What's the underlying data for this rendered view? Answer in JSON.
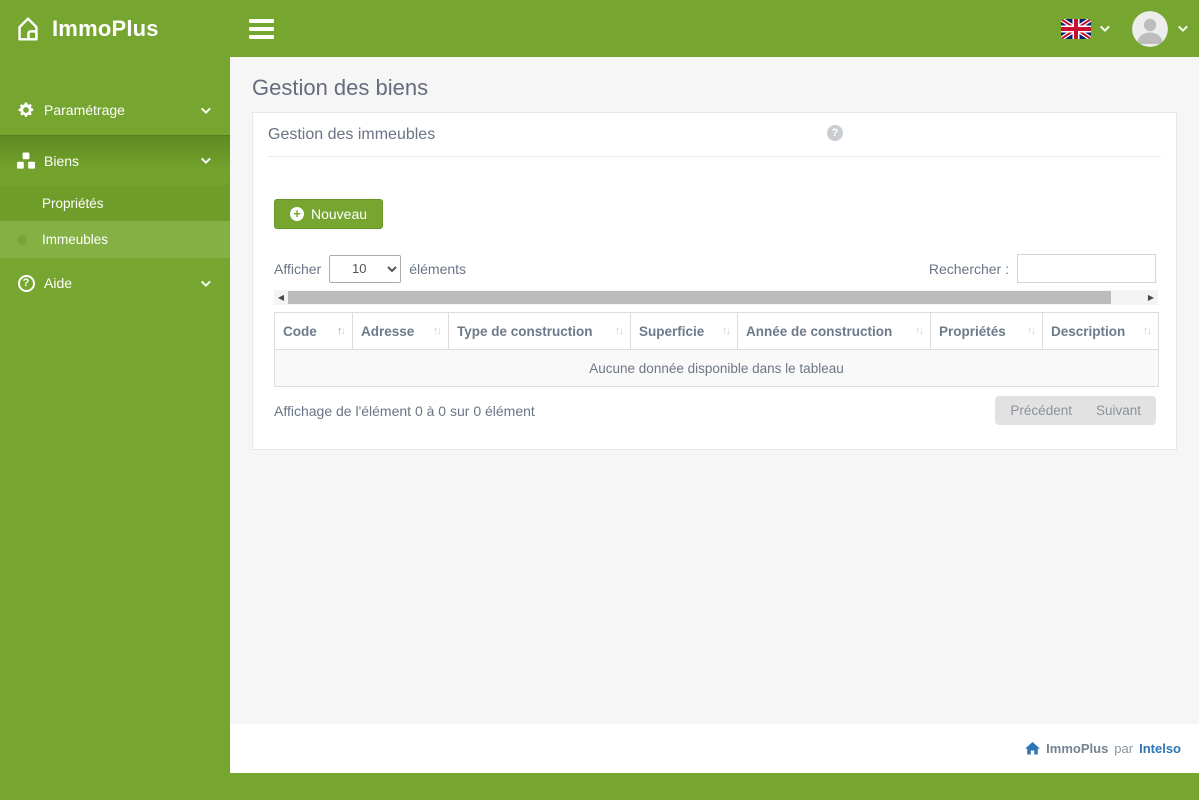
{
  "app": {
    "brand": "ImmoPlus"
  },
  "sidebar": {
    "items": [
      {
        "label": "Paramétrage",
        "icon": "gear-icon"
      },
      {
        "label": "Biens",
        "icon": "cubes-icon",
        "active": true,
        "children": [
          {
            "label": "Propriétés"
          },
          {
            "label": "Immeubles",
            "active": true
          }
        ]
      },
      {
        "label": "Aide",
        "icon": "question-circle-icon"
      }
    ]
  },
  "page": {
    "title": "Gestion des biens"
  },
  "panel": {
    "title": "Gestion des immeubles"
  },
  "toolbar": {
    "new_button": "Nouveau"
  },
  "length_control": {
    "prefix": "Afficher",
    "value": "10",
    "suffix": "éléments"
  },
  "search": {
    "label": "Rechercher :",
    "value": ""
  },
  "table": {
    "columns": [
      "Code",
      "Adresse",
      "Type de construction",
      "Superficie",
      "Année de construction",
      "Propriétés",
      "Description"
    ],
    "sorted_column": "Code",
    "empty_message": "Aucune donnée disponible dans le tableau",
    "info": "Affichage de l'élément 0 à 0 sur 0 élément"
  },
  "pagination": {
    "previous": "Précédent",
    "next": "Suivant"
  },
  "footer": {
    "brand": "ImmoPlus",
    "separator": "par",
    "company": "Intelso"
  },
  "icons": {
    "plus": "+",
    "question_mark": "?",
    "sort_asc": "↑",
    "sort_desc": "↓",
    "scroll_left": "◀",
    "scroll_right": "▶"
  },
  "colors": {
    "brand_green": "#76a530",
    "link_blue": "#2e75b5",
    "submenu_active_green": "#85b144"
  }
}
